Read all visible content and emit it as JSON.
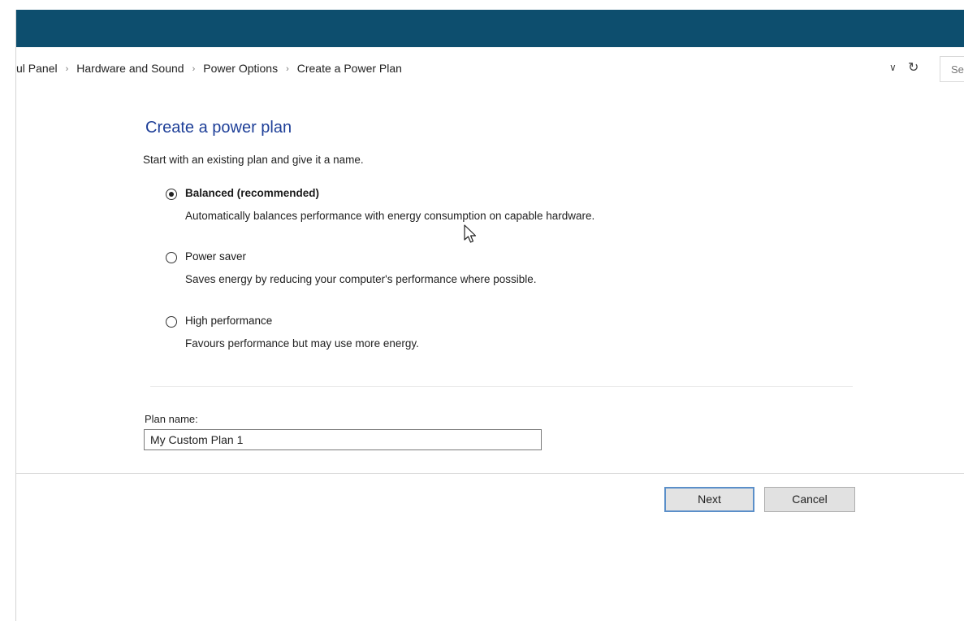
{
  "breadcrumb": {
    "items": [
      "ul Panel",
      "Hardware and Sound",
      "Power Options",
      "Create a Power Plan"
    ],
    "separator": "›"
  },
  "address_bar": {
    "dropdown_icon": "chevron-down-icon",
    "refresh_icon": "refresh-icon",
    "search_placeholder": "Se"
  },
  "page": {
    "title": "Create a power plan",
    "subtitle": "Start with an existing plan and give it a name."
  },
  "plans": [
    {
      "label": "Balanced (recommended)",
      "description": "Automatically balances performance with energy consumption on capable hardware.",
      "selected": true
    },
    {
      "label": "Power saver",
      "description": "Saves energy by reducing your computer's performance where possible.",
      "selected": false
    },
    {
      "label": "High performance",
      "description": "Favours performance but may use more energy.",
      "selected": false
    }
  ],
  "plan_name": {
    "label": "Plan name:",
    "value": "My Custom Plan 1"
  },
  "buttons": {
    "next": "Next",
    "cancel": "Cancel"
  },
  "colors": {
    "title_bar": "#0d4e6e",
    "page_title": "#1e3f98",
    "focus_border": "#5b8fc9"
  }
}
